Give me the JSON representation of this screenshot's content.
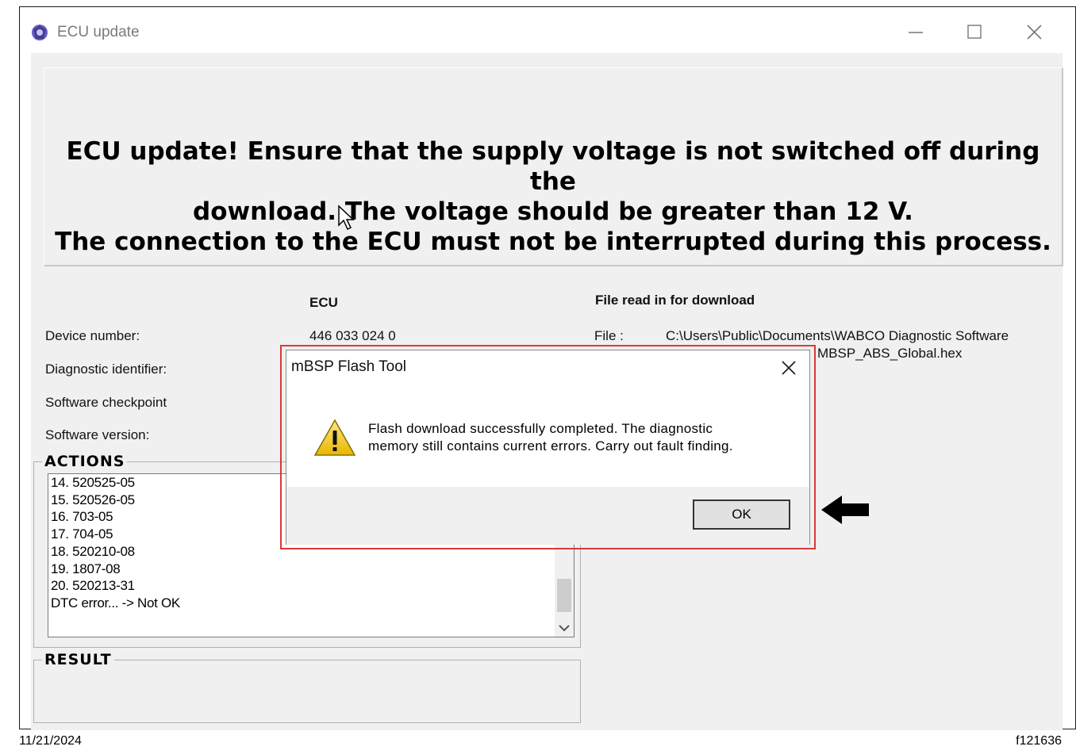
{
  "window": {
    "title": "ECU update",
    "icons": {
      "app": "app-icon",
      "minimize": "minimize-icon",
      "maximize": "maximize-icon",
      "close": "close-icon"
    }
  },
  "banner": {
    "line1": "ECU update! Ensure that the supply voltage is not switched off during the",
    "line2": "download. The voltage should be greater than 12 V.",
    "line3": "The connection to the ECU must not be interrupted during this process."
  },
  "info": {
    "ecu_header": "ECU",
    "file_header": "File read in for download",
    "labels": [
      "Device number:",
      "Diagnostic identifier:",
      "Software checkpoint",
      "Software version:"
    ],
    "device_number": "446 033 024 0",
    "file_label": "File :",
    "file_line1": "C:\\Users\\Public\\Documents\\WABCO Diagnostic Software",
    "file_line2_visible": "MBSP_ABS_Global.hex"
  },
  "actions": {
    "title": "ACTIONS",
    "items": [
      "14. 520525-05",
      "15. 520526-05",
      "16. 703-05",
      "17. 704-05",
      "18. 520210-08",
      "19. 1807-08",
      "20. 520213-31",
      "DTC error... -> Not OK"
    ]
  },
  "result": {
    "title": "RESULT"
  },
  "dialog": {
    "title": "mBSP Flash Tool",
    "message_line1": "Flash download successfully completed. The diagnostic",
    "message_line2": "memory still contains current errors. Carry out fault finding.",
    "ok_label": "OK",
    "icon": "warning-icon"
  },
  "footer": {
    "date": "11/21/2024",
    "figure_id": "f121636"
  },
  "colors": {
    "highlight": "#d83a3a",
    "window_bg": "#f0f0f0"
  }
}
